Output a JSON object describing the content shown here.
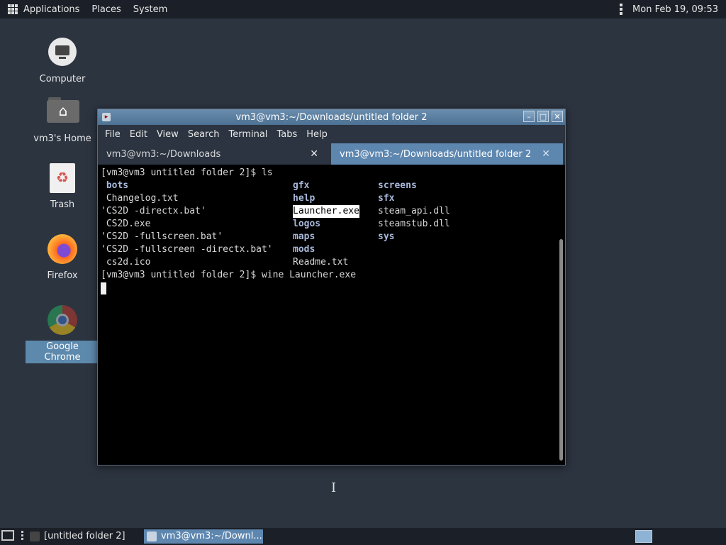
{
  "top_panel": {
    "apps_icon": "grid-icon",
    "menus": [
      "Applications",
      "Places",
      "System"
    ],
    "datetime": "Mon Feb 19, 09:53"
  },
  "desktop_icons": [
    {
      "label": "Computer",
      "icon": "computer-icon"
    },
    {
      "label": "vm3's Home",
      "icon": "home-folder-icon"
    },
    {
      "label": "Trash",
      "icon": "trash-icon"
    },
    {
      "label": "Firefox",
      "icon": "firefox-icon"
    },
    {
      "label": "Google Chrome",
      "icon": "chrome-icon",
      "selected": true
    }
  ],
  "terminal": {
    "title": "vm3@vm3:~/Downloads/untitled folder 2",
    "menu": [
      "File",
      "Edit",
      "View",
      "Search",
      "Terminal",
      "Tabs",
      "Help"
    ],
    "tabs": [
      {
        "label": "vm3@vm3:~/Downloads",
        "active": false
      },
      {
        "label": "vm3@vm3:~/Downloads/untitled folder 2",
        "active": true
      }
    ],
    "prompt1": "[vm3@vm3 untitled folder 2]$ ls",
    "listing": {
      "col1": [
        " bots",
        " Changelog.txt",
        "'CS2D -directx.bat'",
        " CS2D.exe",
        "'CS2D -fullscreen.bat'",
        "'CS2D -fullscreen -directx.bat'",
        " cs2d.ico"
      ],
      "col2": [
        "gfx",
        "help",
        "Launcher.exe",
        "logos",
        "maps",
        "mods",
        "Readme.txt"
      ],
      "col3": [
        "screens",
        "sfx",
        "steam_api.dll",
        "steamstub.dll",
        "sys"
      ]
    },
    "prompt2": "[vm3@vm3 untitled folder 2]$ wine Launcher.exe"
  },
  "taskbar": {
    "tasks": [
      "[untitled folder 2]",
      "vm3@vm3:~/Downl..."
    ]
  }
}
